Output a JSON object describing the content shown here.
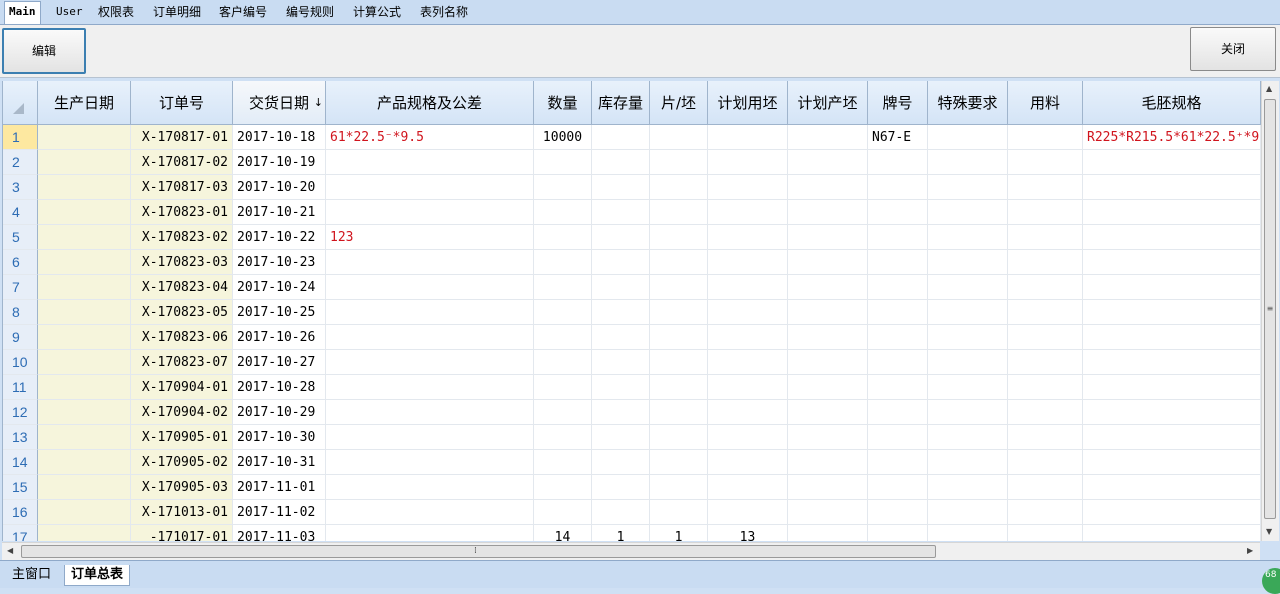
{
  "menu_tabs": [
    "Main",
    "User",
    "权限表",
    "订单明细",
    "客户编号",
    "编号规则",
    "计算公式",
    "表列名称"
  ],
  "toolbar": {
    "edit_label": "编辑",
    "close_label": "关闭"
  },
  "columns": [
    "",
    "生产日期",
    "订单号",
    "交货日期",
    "产品规格及公差",
    "数量",
    "库存量",
    "片/坯",
    "计划用坯",
    "计划产坯",
    "牌号",
    "特殊要求",
    "用料",
    "毛胚规格"
  ],
  "sort_indicator": "↓",
  "rows": [
    {
      "n": "1",
      "order": "X-170817-01",
      "date": "2017-10-18",
      "spec": "61*22.5⁻*9.5",
      "qty": "10000",
      "stock": "",
      "pieces": "",
      "plan_use": "",
      "plan_out": "",
      "grade": "N67-E",
      "special": "",
      "material": "",
      "blank": "R225*R215.5*61*22.5⁺*9."
    },
    {
      "n": "2",
      "order": "X-170817-02",
      "date": "2017-10-19",
      "spec": "",
      "qty": "",
      "stock": "",
      "pieces": "",
      "plan_use": "",
      "plan_out": "",
      "grade": "",
      "special": "",
      "material": "",
      "blank": ""
    },
    {
      "n": "3",
      "order": "X-170817-03",
      "date": "2017-10-20",
      "spec": "",
      "qty": "",
      "stock": "",
      "pieces": "",
      "plan_use": "",
      "plan_out": "",
      "grade": "",
      "special": "",
      "material": "",
      "blank": ""
    },
    {
      "n": "4",
      "order": "X-170823-01",
      "date": "2017-10-21",
      "spec": "",
      "qty": "",
      "stock": "",
      "pieces": "",
      "plan_use": "",
      "plan_out": "",
      "grade": "",
      "special": "",
      "material": "",
      "blank": ""
    },
    {
      "n": "5",
      "order": "X-170823-02",
      "date": "2017-10-22",
      "spec": "123",
      "qty": "",
      "stock": "",
      "pieces": "",
      "plan_use": "",
      "plan_out": "",
      "grade": "",
      "special": "",
      "material": "",
      "blank": ""
    },
    {
      "n": "6",
      "order": "X-170823-03",
      "date": "2017-10-23",
      "spec": "",
      "qty": "",
      "stock": "",
      "pieces": "",
      "plan_use": "",
      "plan_out": "",
      "grade": "",
      "special": "",
      "material": "",
      "blank": ""
    },
    {
      "n": "7",
      "order": "X-170823-04",
      "date": "2017-10-24",
      "spec": "",
      "qty": "",
      "stock": "",
      "pieces": "",
      "plan_use": "",
      "plan_out": "",
      "grade": "",
      "special": "",
      "material": "",
      "blank": ""
    },
    {
      "n": "8",
      "order": "X-170823-05",
      "date": "2017-10-25",
      "spec": "",
      "qty": "",
      "stock": "",
      "pieces": "",
      "plan_use": "",
      "plan_out": "",
      "grade": "",
      "special": "",
      "material": "",
      "blank": ""
    },
    {
      "n": "9",
      "order": "X-170823-06",
      "date": "2017-10-26",
      "spec": "",
      "qty": "",
      "stock": "",
      "pieces": "",
      "plan_use": "",
      "plan_out": "",
      "grade": "",
      "special": "",
      "material": "",
      "blank": ""
    },
    {
      "n": "10",
      "order": "X-170823-07",
      "date": "2017-10-27",
      "spec": "",
      "qty": "",
      "stock": "",
      "pieces": "",
      "plan_use": "",
      "plan_out": "",
      "grade": "",
      "special": "",
      "material": "",
      "blank": ""
    },
    {
      "n": "11",
      "order": "X-170904-01",
      "date": "2017-10-28",
      "spec": "",
      "qty": "",
      "stock": "",
      "pieces": "",
      "plan_use": "",
      "plan_out": "",
      "grade": "",
      "special": "",
      "material": "",
      "blank": ""
    },
    {
      "n": "12",
      "order": "X-170904-02",
      "date": "2017-10-29",
      "spec": "",
      "qty": "",
      "stock": "",
      "pieces": "",
      "plan_use": "",
      "plan_out": "",
      "grade": "",
      "special": "",
      "material": "",
      "blank": ""
    },
    {
      "n": "13",
      "order": "X-170905-01",
      "date": "2017-10-30",
      "spec": "",
      "qty": "",
      "stock": "",
      "pieces": "",
      "plan_use": "",
      "plan_out": "",
      "grade": "",
      "special": "",
      "material": "",
      "blank": ""
    },
    {
      "n": "14",
      "order": "X-170905-02",
      "date": "2017-10-31",
      "spec": "",
      "qty": "",
      "stock": "",
      "pieces": "",
      "plan_use": "",
      "plan_out": "",
      "grade": "",
      "special": "",
      "material": "",
      "blank": ""
    },
    {
      "n": "15",
      "order": "X-170905-03",
      "date": "2017-11-01",
      "spec": "",
      "qty": "",
      "stock": "",
      "pieces": "",
      "plan_use": "",
      "plan_out": "",
      "grade": "",
      "special": "",
      "material": "",
      "blank": ""
    },
    {
      "n": "16",
      "order": "X-171013-01",
      "date": "2017-11-02",
      "spec": "",
      "qty": "",
      "stock": "",
      "pieces": "",
      "plan_use": "",
      "plan_out": "",
      "grade": "",
      "special": "",
      "material": "",
      "blank": ""
    },
    {
      "n": "17",
      "order": "-171017-01",
      "date": "2017-11-03",
      "spec": "",
      "qty": "14",
      "stock": "1",
      "pieces": "1",
      "plan_use": "13",
      "plan_out": "",
      "grade": "",
      "special": "",
      "material": "",
      "blank": ""
    }
  ],
  "bottom_tabs": [
    "主窗口",
    "订单总表"
  ],
  "corner_badge": "68",
  "grip": "⁞",
  "colors": {
    "accent": "#3c7fb1",
    "header_bg": "#d4e4f6",
    "red_text": "#d0141d",
    "row_number": "#2d6cb4"
  }
}
